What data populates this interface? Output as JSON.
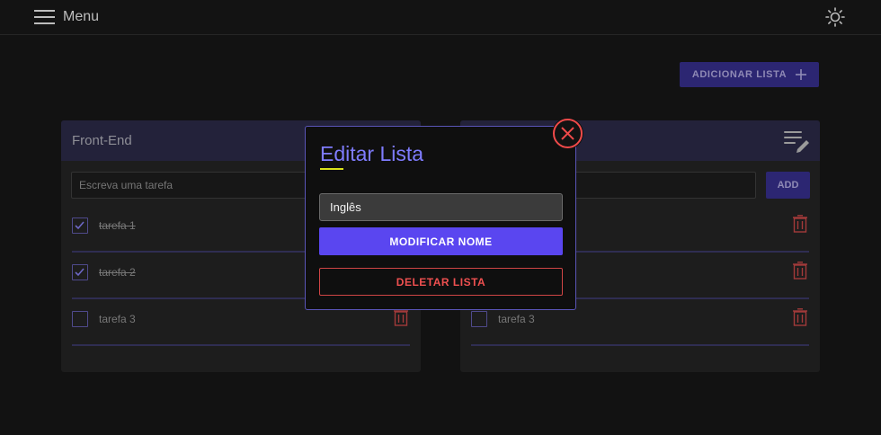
{
  "header": {
    "menu_label": "Menu",
    "menu_icon": "hamburger-icon",
    "theme_icon": "sun-icon"
  },
  "toolbar": {
    "add_list_label": "ADICIONAR LISTA",
    "add_list_icon": "plus-icon"
  },
  "lists": [
    {
      "title": "Front-End",
      "task_placeholder": "Escreva uma tarefa",
      "tasks": [
        {
          "label": "tarefa 1",
          "done": true
        },
        {
          "label": "tarefa 2",
          "done": true
        },
        {
          "label": "tarefa 3",
          "done": false
        }
      ]
    },
    {
      "title": "",
      "task_placeholder": "",
      "add_label": "ADD",
      "tasks": [
        {
          "label": "",
          "done": false
        },
        {
          "label": "",
          "done": false
        },
        {
          "label": "tarefa 3",
          "done": false
        }
      ]
    }
  ],
  "modal": {
    "title": "Editar Lista",
    "name_value": "Inglês",
    "modify_label": "MODIFICAR NOME",
    "delete_label": "DELETAR LISTA",
    "close_icon": "close-circle-icon"
  },
  "colors": {
    "accent": "#5a46f0",
    "accent_text": "#7f7cff",
    "danger": "#ef5050",
    "highlight": "#d9e21b"
  }
}
